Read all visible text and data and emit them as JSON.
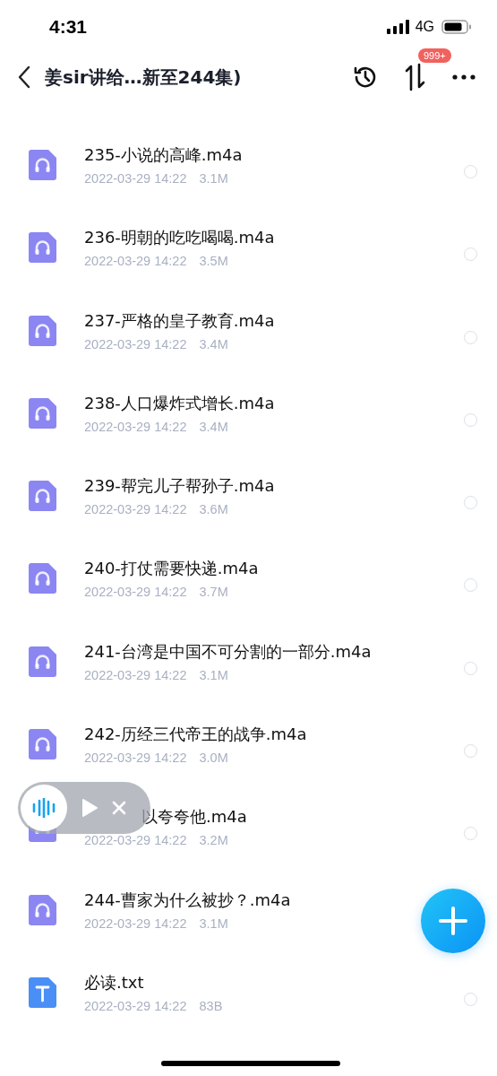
{
  "status_bar": {
    "time": "4:31",
    "network": "4G"
  },
  "nav": {
    "title": "姜sir讲给…新至244集)",
    "badge": "999+"
  },
  "files": [
    {
      "kind": "audio",
      "name": "235-小说的高峰.m4a",
      "date": "2022-03-29 14:22",
      "size": "3.1M",
      "checked": false
    },
    {
      "kind": "audio",
      "name": "236-明朝的吃吃喝喝.m4a",
      "date": "2022-03-29 14:22",
      "size": "3.5M",
      "checked": false
    },
    {
      "kind": "audio",
      "name": "237-严格的皇子教育.m4a",
      "date": "2022-03-29 14:22",
      "size": "3.4M",
      "checked": false
    },
    {
      "kind": "audio",
      "name": "238-人口爆炸式增长.m4a",
      "date": "2022-03-29 14:22",
      "size": "3.4M",
      "checked": false
    },
    {
      "kind": "audio",
      "name": "239-帮完儿子帮孙子.m4a",
      "date": "2022-03-29 14:22",
      "size": "3.6M",
      "checked": false
    },
    {
      "kind": "audio",
      "name": "240-打仗需要快递.m4a",
      "date": "2022-03-29 14:22",
      "size": "3.7M",
      "checked": false
    },
    {
      "kind": "audio",
      "name": "241-台湾是中国不可分割的一部分.m4a",
      "date": "2022-03-29 14:22",
      "size": "3.1M",
      "checked": false
    },
    {
      "kind": "audio",
      "name": "242-历经三代帝王的战争.m4a",
      "date": "2022-03-29 14:22",
      "size": "3.0M",
      "checked": false
    },
    {
      "kind": "audio",
      "name": "以夸夸他.m4a",
      "covered_by_player": true,
      "date": "2022-03-29 14:22",
      "size": "3.2M",
      "checked": false
    },
    {
      "kind": "audio",
      "name": "244-曹家为什么被抄？.m4a",
      "date": "2022-03-29 14:22",
      "size": "3.1M"
    },
    {
      "kind": "text",
      "name": "必读.txt",
      "date": "2022-03-29 14:22",
      "size": "83B",
      "checked": false
    }
  ]
}
